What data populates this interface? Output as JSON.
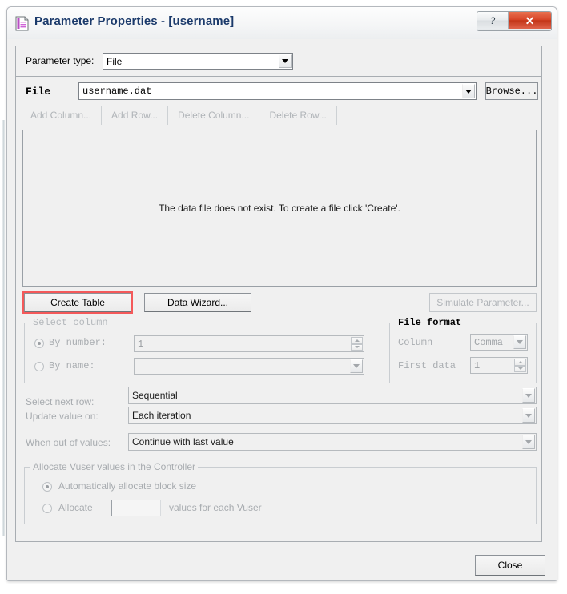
{
  "window": {
    "title": "Parameter Properties - [username]",
    "icon": "parameter-file-icon",
    "help_button": "?",
    "close_button": "✕"
  },
  "parameter_type": {
    "label": "Parameter type:",
    "value": "File"
  },
  "file": {
    "label": "File",
    "value": "username.dat",
    "browse_label": "Browse..."
  },
  "toolbar": {
    "add_column": "Add Column...",
    "add_row": "Add Row...",
    "delete_column": "Delete Column...",
    "delete_row": "Delete Row..."
  },
  "data_area": {
    "message": "The data file does not exist. To create a file click 'Create'."
  },
  "actions": {
    "create_table": "Create Table",
    "data_wizard": "Data Wizard...",
    "simulate_parameter": "Simulate Parameter..."
  },
  "select_column": {
    "title": "Select column",
    "by_number_label": "By number:",
    "by_number_value": "1",
    "by_name_label": "By name:",
    "by_name_value": ""
  },
  "file_format": {
    "title": "File format",
    "column_label": "Column",
    "column_value": "Comma",
    "first_data_label": "First data",
    "first_data_value": "1"
  },
  "rows": {
    "select_next_row_label": "Select next row:",
    "select_next_row_value": "Sequential",
    "update_value_on_label": "Update value on:",
    "update_value_on_value": "Each iteration",
    "when_out_of_values_label": "When out of values:",
    "when_out_of_values_value": "Continue with last value"
  },
  "allocate": {
    "title": "Allocate Vuser values in the Controller",
    "automatic_label": "Automatically allocate block size",
    "allocate_label": "Allocate",
    "allocate_value": "",
    "allocate_suffix": "values for each Vuser"
  },
  "footer": {
    "close_label": "Close"
  },
  "colors": {
    "title_text": "#1b3a6b",
    "highlight": "#f4595a",
    "close_button": "#d8472a",
    "dialog_bg": "#f0f0f0"
  }
}
